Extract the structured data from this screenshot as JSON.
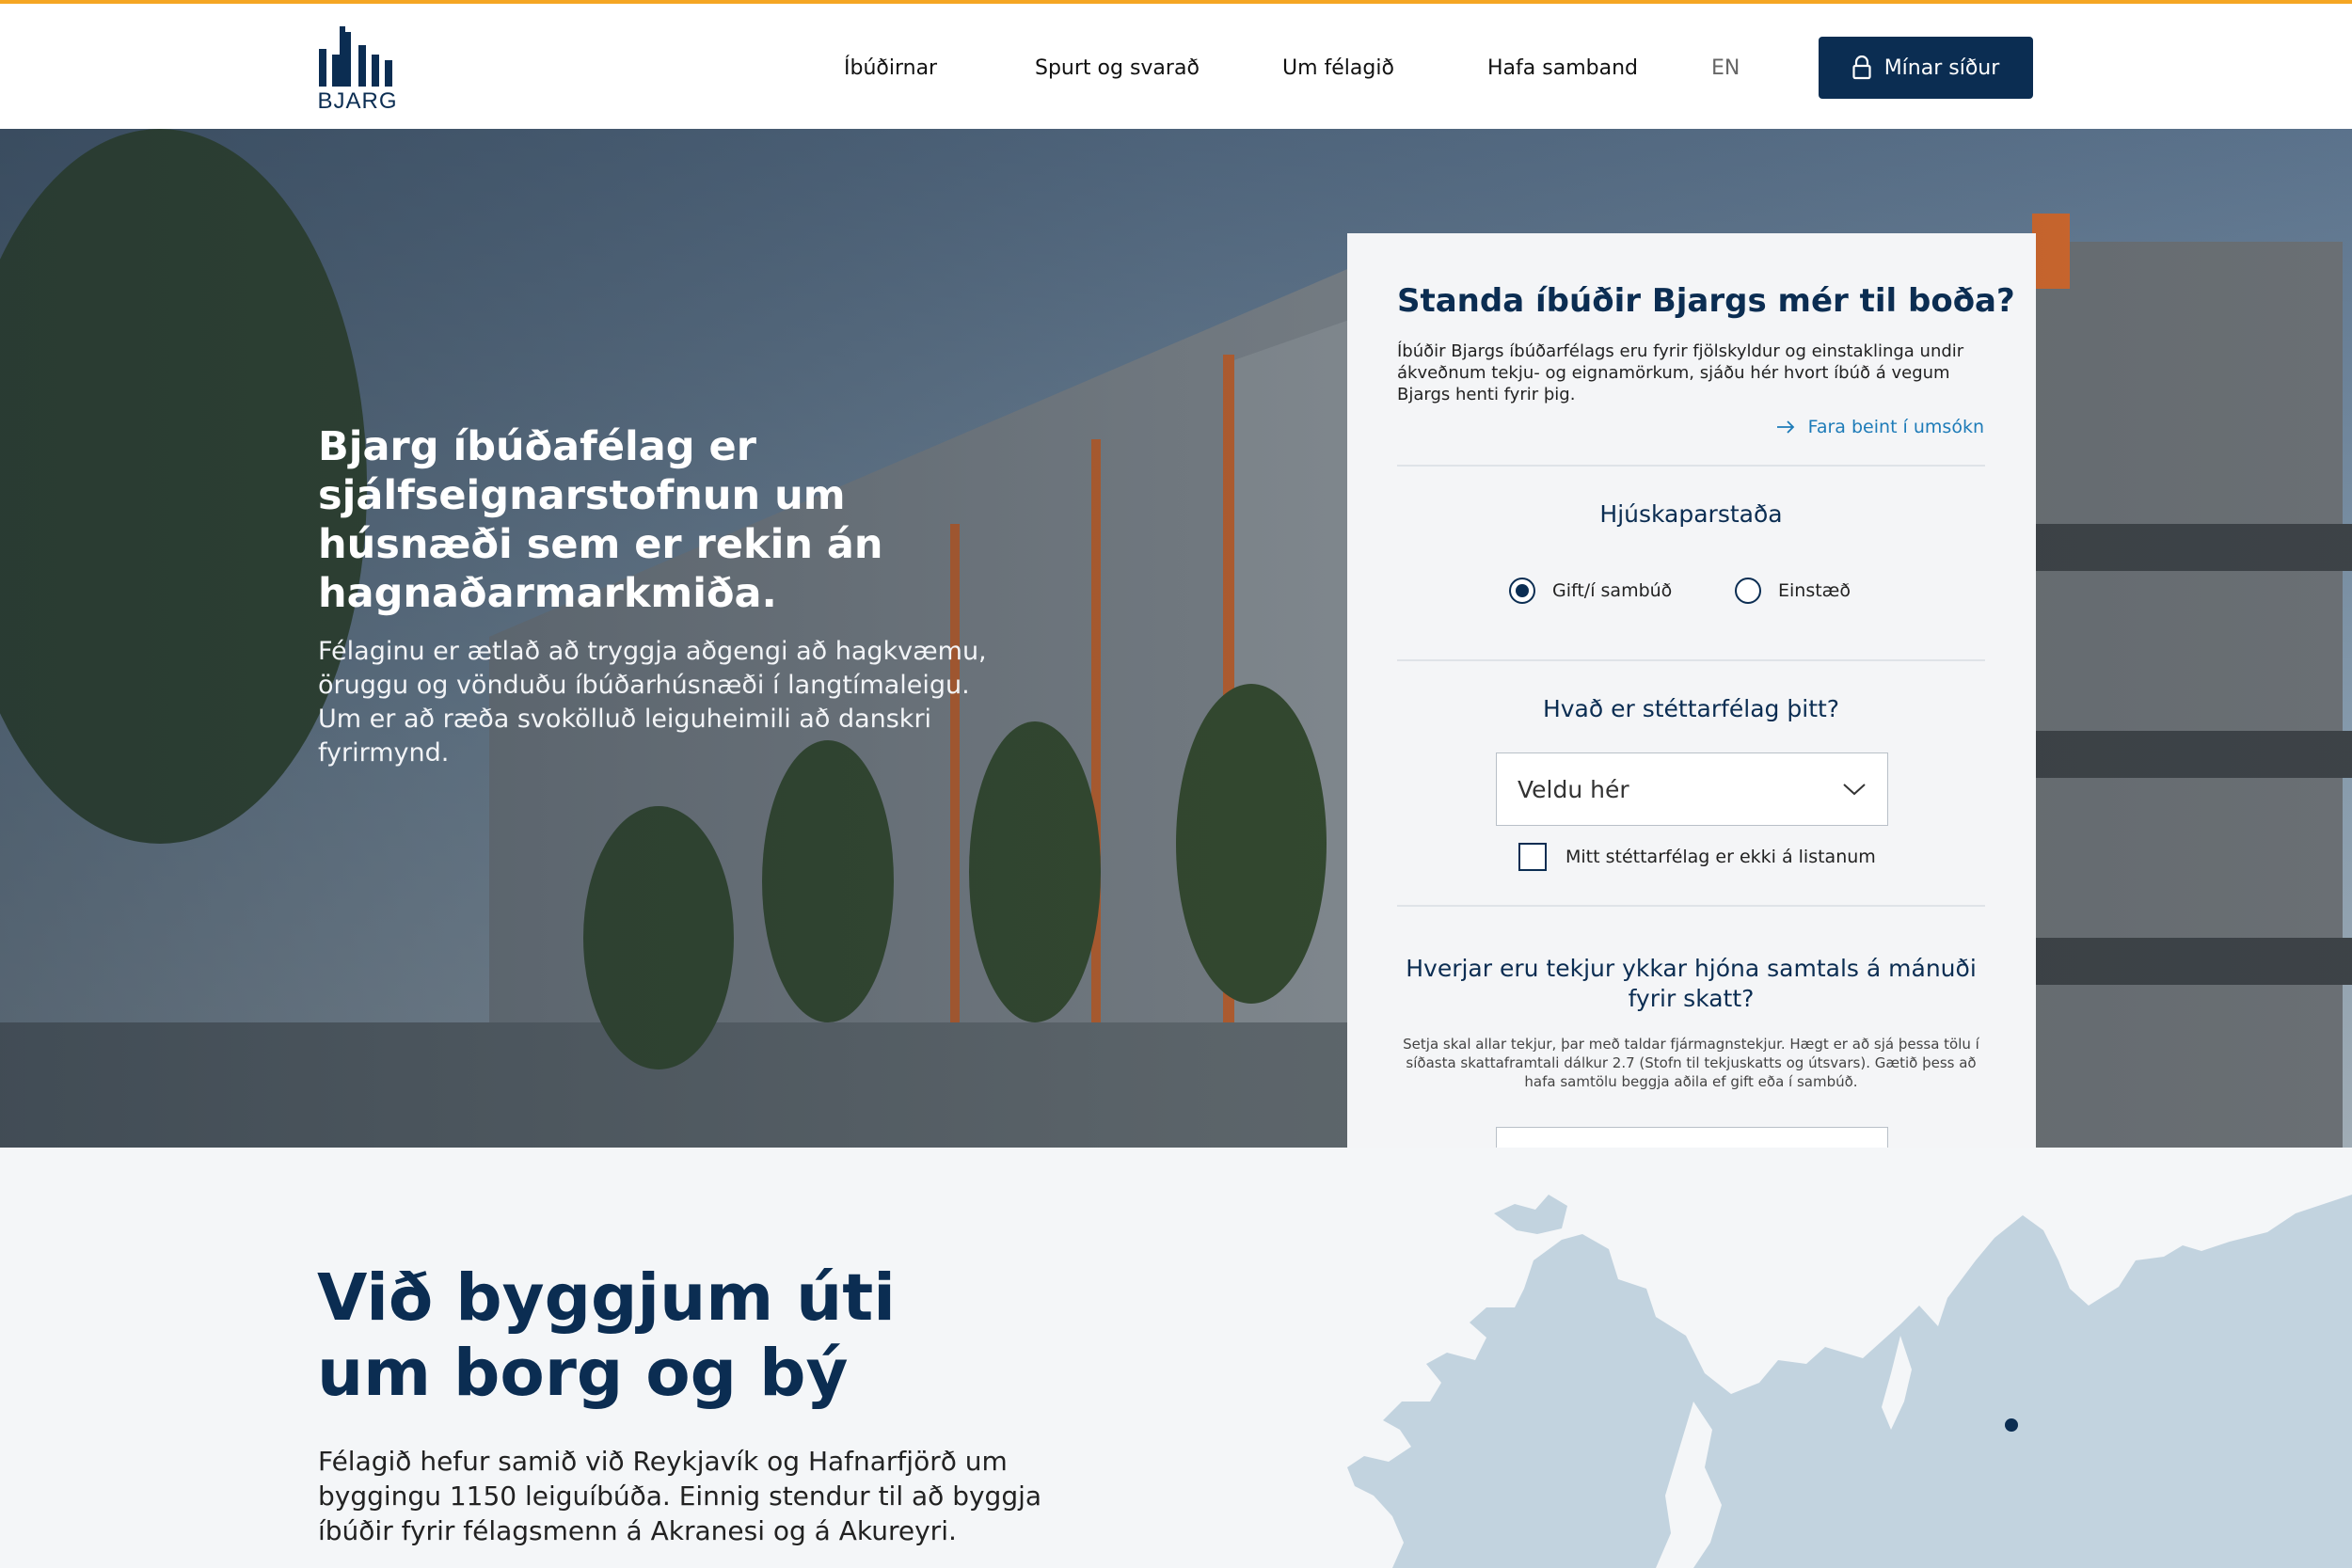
{
  "header": {
    "logo_text": "BJARG",
    "nav": [
      "Íbúðirnar",
      "Spurt og svarað",
      "Um félagið",
      "Hafa samband"
    ],
    "lang": "EN",
    "account_button": "Mínar síður"
  },
  "hero": {
    "title": "Bjarg íbúðafélag er sjálfseignarstofnun um húsnæði sem er rekin án hagnaðarmarkmiða.",
    "body": "Félaginu er ætlað að tryggja aðgengi að hagkvæmu, öruggu og vönduðu íbúðarhúsnæði í langtímaleigu. Um er að ræða svokölluð leiguheimili að danskri fyrirmynd."
  },
  "eligibility_form": {
    "title": "Standa íbúðir Bjargs mér til boða?",
    "intro": "Íbúðir Bjargs íbúðarfélags eru fyrir fjölskyldur og einstaklinga undir ákveðnum tekju- og eignamörkum, sjáðu hér hvort íbúð á vegum Bjargs henti fyrir þig.",
    "apply_link": "Fara beint í umsókn",
    "marital": {
      "label": "Hjúskaparstaða",
      "options": [
        "Gift/í sambúð",
        "Einstæð"
      ],
      "selected": "Gift/í sambúð"
    },
    "union": {
      "label": "Hvað er stéttarfélag þitt?",
      "select_value": "Veldu hér",
      "not_listed_label": "Mitt stéttarfélag er ekki á listanum",
      "not_listed_checked": false
    },
    "income": {
      "label": "Hverjar eru tekjur ykkar hjóna samtals á mánuði fyrir skatt?",
      "help": "Setja skal allar tekjur, þar með taldar fjármagnstekjur. Hægt er að sjá þessa tölu í síðasta skattaframtali dálkur 2.7 (Stofn til tekjuskatts og útsvars). Gætið þess að hafa samtölu beggja aðila ef gift eða í sambúð."
    }
  },
  "section2": {
    "title_line1": "Við byggjum úti",
    "title_line2": "um borg og bý",
    "body": "Félagið hefur samið við Reykjavík og Hafnarfjörð um byggingu 1150 leiguíbúða. Einnig stendur til að byggja íbúðir fyrir félagsmenn á Akranesi og á Akureyri."
  },
  "colors": {
    "brand_navy": "#0b2d52",
    "accent_orange": "#f5a623",
    "link_blue": "#1d7bb8",
    "map_fill": "#c2d3df"
  },
  "icons": [
    "bjarg-logo-icon",
    "lock-icon",
    "arrow-right-icon",
    "chevron-down-icon",
    "map-location-dot-icon"
  ]
}
